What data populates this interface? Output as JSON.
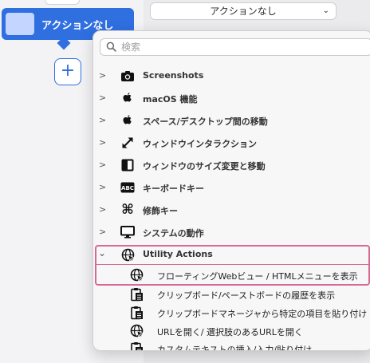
{
  "left_panel": {
    "action_card_label": "アクションなし",
    "add_button_label": "+"
  },
  "top_dropdown": {
    "label": "アクションなし",
    "chevron": "⌄"
  },
  "popup": {
    "search_placeholder": "検索",
    "categories": [
      {
        "label": "Screenshots",
        "icon": "camera-icon"
      },
      {
        "label": "macOS 機能",
        "icon": "apple-icon"
      },
      {
        "label": "スペース/デスクトップ間の移動",
        "icon": "apple-icon"
      },
      {
        "label": "ウィンドウインタラクション",
        "icon": "resize-arrows-icon"
      },
      {
        "label": "ウィンドウのサイズ変更と移動",
        "icon": "window-split-icon"
      },
      {
        "label": "キーボードキー",
        "icon": "abc-key-icon"
      },
      {
        "label": "修飾キー",
        "icon": "command-key-icon"
      },
      {
        "label": "システムの動作",
        "icon": "monitor-icon"
      },
      {
        "label": "Utility Actions",
        "icon": "globe-cursor-icon",
        "expanded": true
      }
    ],
    "utility_items": [
      {
        "label": "フローティングWebビュー / HTMLメニューを表示",
        "icon": "globe-cursor-icon"
      },
      {
        "label": "クリップボード/ペーストボードの履歴を表示",
        "icon": "clipboard-icon"
      },
      {
        "label": "クリップボードマネージャから特定の項目を貼り付け",
        "icon": "clipboard-icon"
      },
      {
        "label": "URLを開く/ 選択肢のあるURLを開く",
        "icon": "globe-cursor-icon"
      },
      {
        "label": "カスタムテキストの挿入/入力/貼り付け",
        "icon": "clipboard-icon"
      }
    ],
    "highlight_color": "#d66a95"
  },
  "colors": {
    "accent": "#2f6fe0"
  }
}
